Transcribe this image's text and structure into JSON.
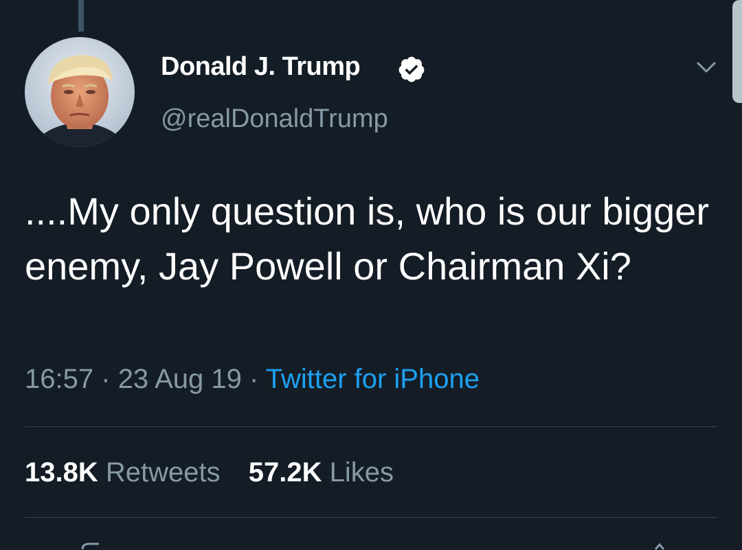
{
  "author": {
    "display_name": "Donald J. Trump",
    "handle": "@realDonaldTrump",
    "verified": true,
    "avatar_icon": "user-avatar-photo"
  },
  "tweet": {
    "text": "....My only question is, who is our bigger enemy, Jay Powell or Chairman Xi?",
    "time": "16:57",
    "separator": "·",
    "date": "23 Aug 19",
    "source": "Twitter for iPhone"
  },
  "stats": {
    "retweets_count": "13.8K",
    "retweets_label": "Retweets",
    "likes_count": "57.2K",
    "likes_label": "Likes"
  },
  "icons": {
    "verified": "verified-badge-icon",
    "menu": "chevron-down-icon"
  },
  "colors": {
    "background": "#141d26",
    "primary_text": "#ffffff",
    "secondary_text": "#8899a6",
    "link": "#1da1f2",
    "divider": "#38444d"
  }
}
